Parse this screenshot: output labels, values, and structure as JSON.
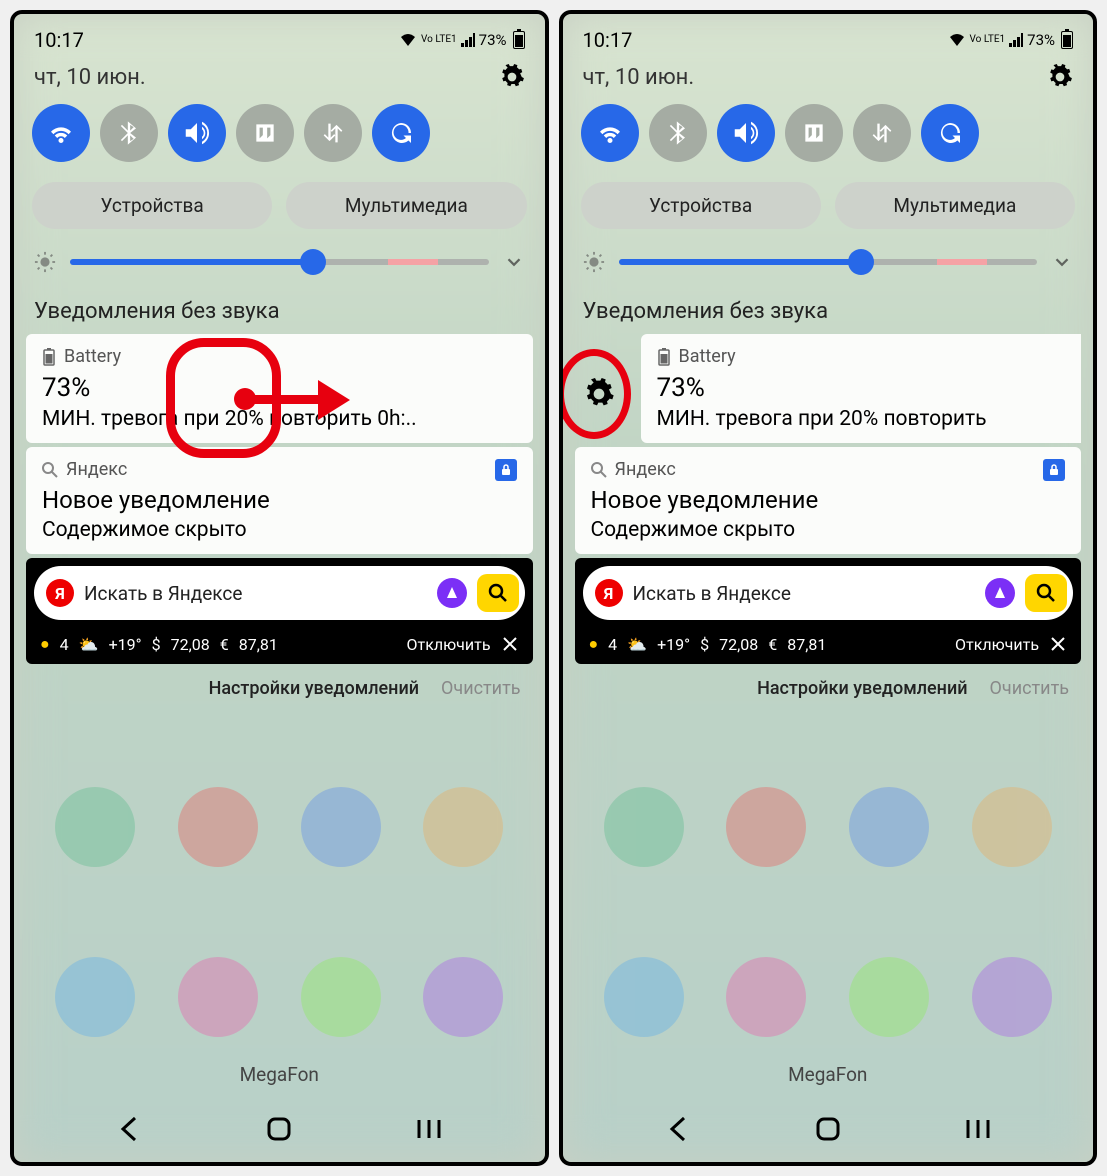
{
  "status": {
    "time": "10:17",
    "network": "Vo LTE1",
    "battery_pct": "73%"
  },
  "date_row": {
    "date": "чт, 10 июн."
  },
  "quick_settings": [
    {
      "name": "wifi",
      "active": true
    },
    {
      "name": "bluetooth",
      "active": false
    },
    {
      "name": "sound",
      "active": true
    },
    {
      "name": "nfc",
      "active": false
    },
    {
      "name": "data-transfer",
      "active": false
    },
    {
      "name": "rotate",
      "active": true
    }
  ],
  "pills": {
    "devices": "Устройства",
    "media": "Мультимедиа"
  },
  "section_title": "Уведомления без звука",
  "notifications": {
    "battery": {
      "app": "Battery",
      "title": "73%",
      "body_left": "МИН. тревога при 20% повторить 0h:..",
      "body_right": "МИН. тревога при 20% повторить"
    },
    "yandex": {
      "app": "Яндекс",
      "title": "Новое уведомление",
      "body": "Содержимое скрыто"
    }
  },
  "yandex_widget": {
    "search_placeholder": "Искать в Яндексе",
    "logo_letter": "Я",
    "weather_dot": "4",
    "weather_temp": "+19°",
    "usd": "72,08",
    "eur": "87,81",
    "disable": "Отключить"
  },
  "notif_actions": {
    "settings": "Настройки уведомлений",
    "clear": "Очистить"
  },
  "carrier": "MegaFon"
}
